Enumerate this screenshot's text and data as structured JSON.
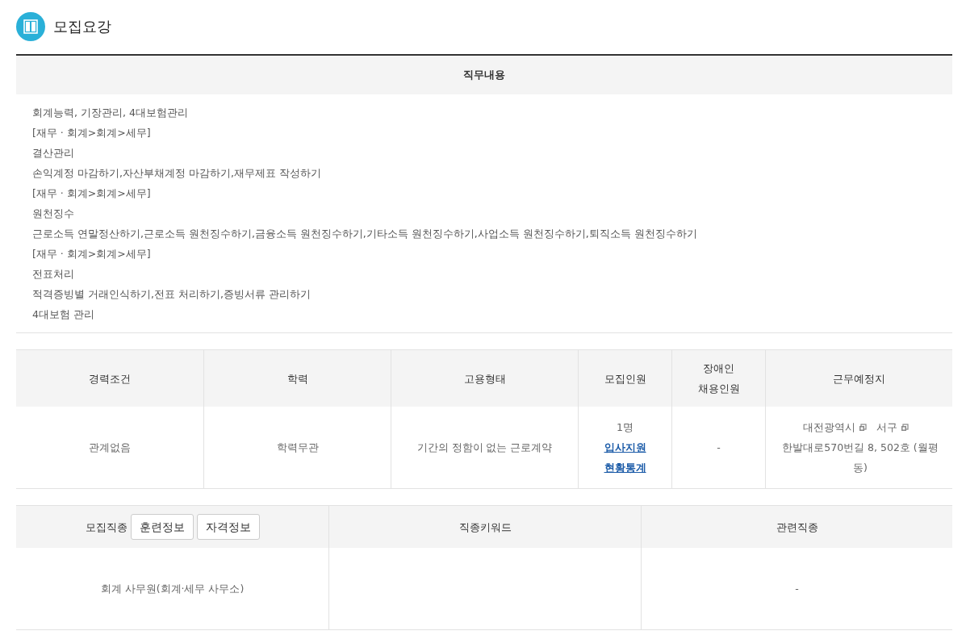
{
  "title": "모집요강",
  "duties": {
    "heading": "직무내용",
    "lines": [
      "회계능력, 기장관리, 4대보험관리",
      "[재무 · 회계>회계>세무]",
      "결산관리",
      "손익계정 마감하기,자산부채계정 마감하기,재무제표 작성하기",
      "[재무 · 회계>회계>세무]",
      "원천징수",
      "근로소득 연말정산하기,근로소득 원천징수하기,금융소득 원천징수하기,기타소득 원천징수하기,사업소득 원천징수하기,퇴직소득 원천징수하기",
      "[재무 · 회계>회계>세무]",
      "전표처리",
      "적격증빙별 거래인식하기,전표 처리하기,증빙서류 관리하기",
      "4대보험 관리"
    ]
  },
  "conditions": {
    "columns": [
      {
        "lines": [
          "경력조건"
        ]
      },
      {
        "lines": [
          "학력"
        ]
      },
      {
        "lines": [
          "고용형태"
        ]
      },
      {
        "lines": [
          "모집인원"
        ]
      },
      {
        "lines": [
          "장애인",
          "채용인원"
        ]
      },
      {
        "lines": [
          "근무예정지"
        ]
      }
    ],
    "experience": "관계없음",
    "education": "학력무관",
    "employment_type": "기간의 정함이 없는 근로계약",
    "headcount": "1명",
    "stats_link": "입사지원 현황통계",
    "disabled_hiring": "-",
    "location": {
      "regions": [
        "대전광역시",
        "서구"
      ],
      "address": "한발대로570번길 8, 502호 (월평동)"
    }
  },
  "jobs": {
    "first_column": "모집직종",
    "buttons": [
      "훈련정보",
      "자격정보"
    ],
    "columns": [
      "직종키워드",
      "관련직종"
    ],
    "occupation": "회계 사무원(회계·세무 사무소)",
    "related": "-"
  }
}
